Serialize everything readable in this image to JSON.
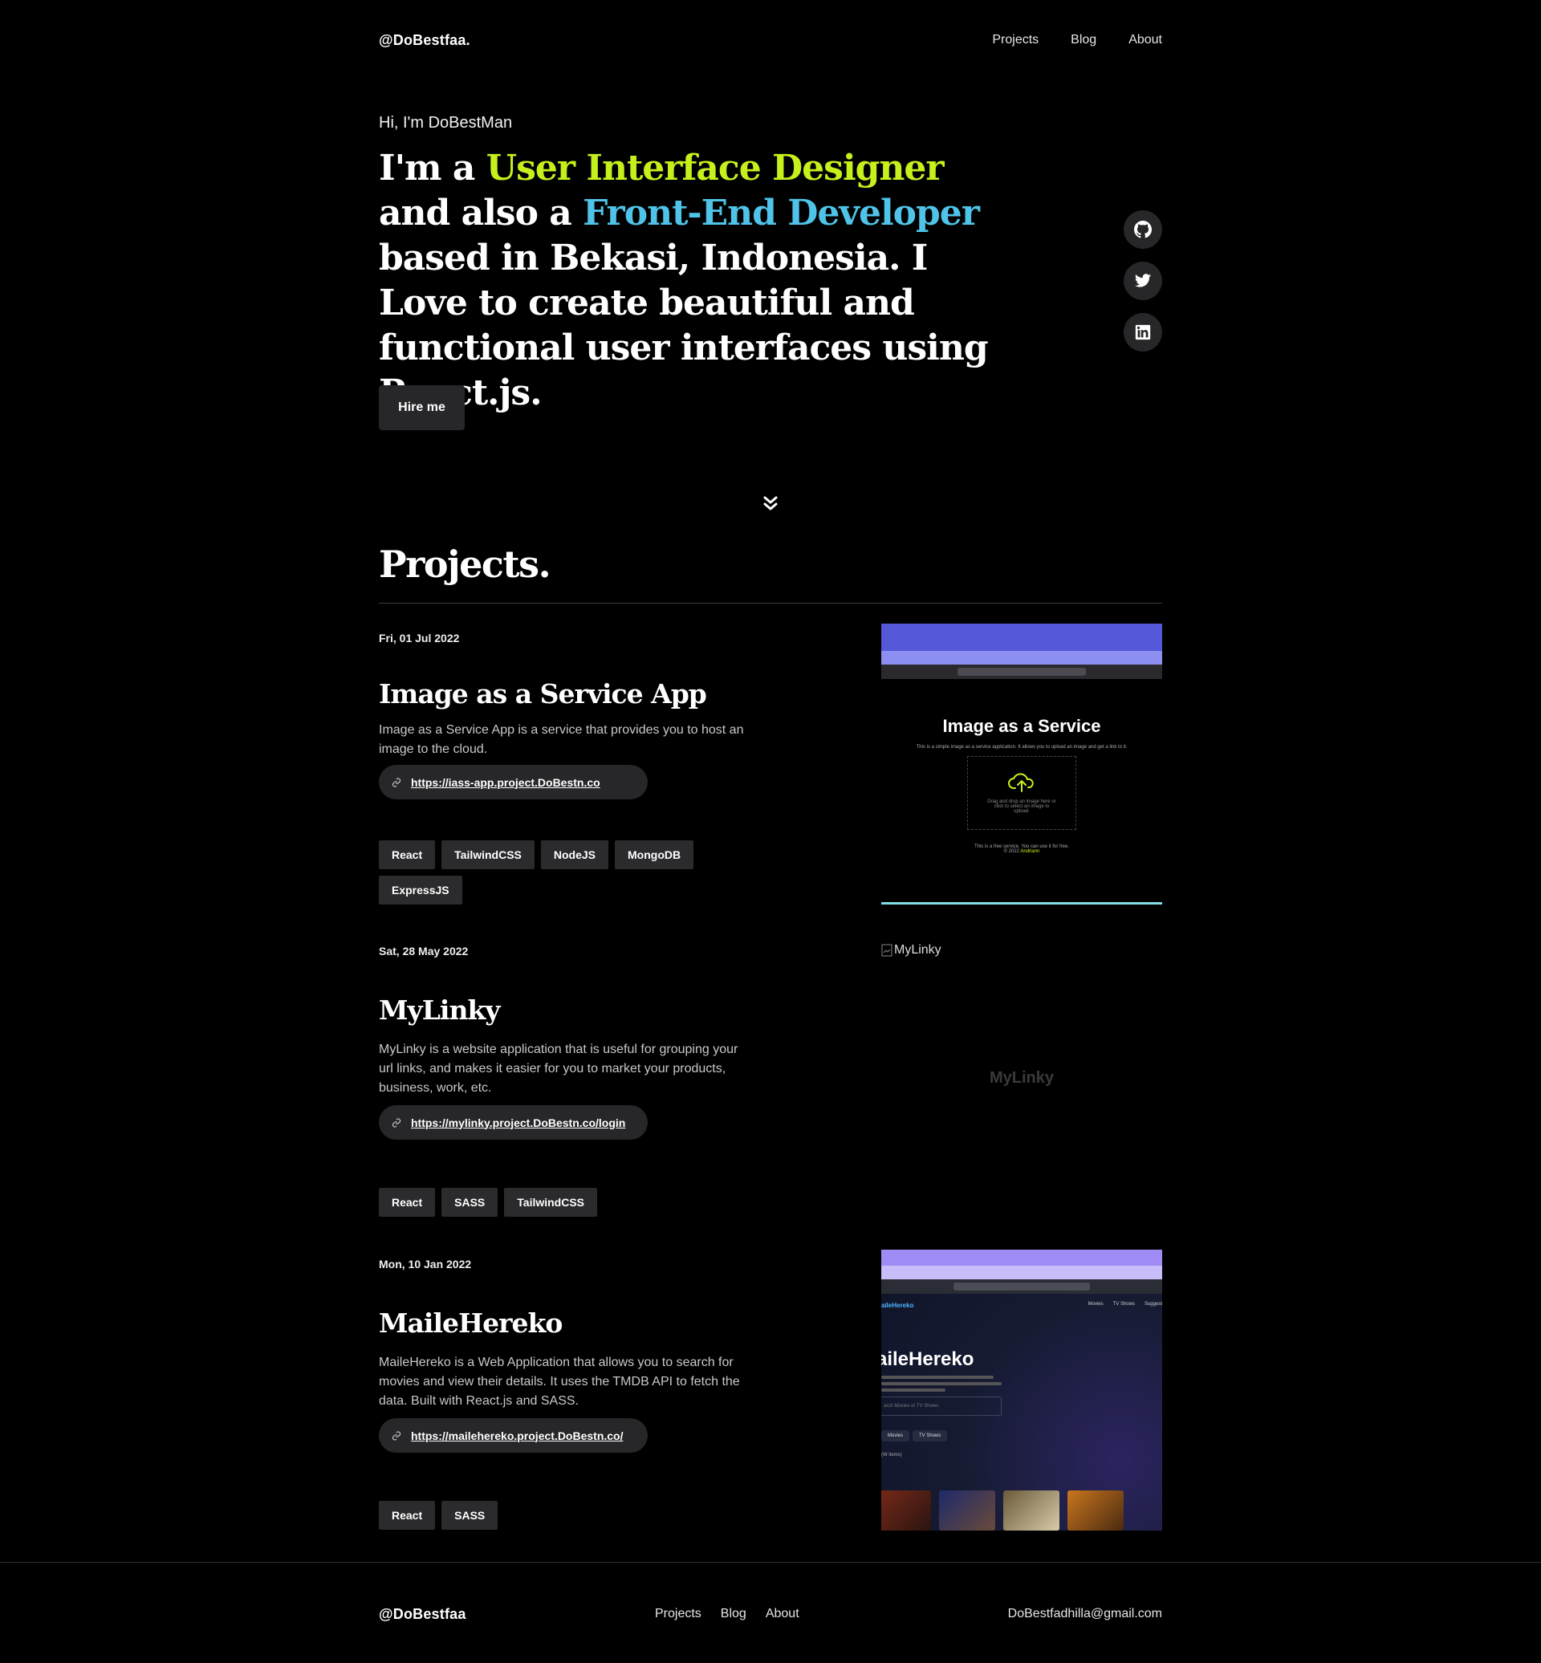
{
  "nav": {
    "brand": "@DoBestfaa.",
    "links": [
      "Projects",
      "Blog",
      "About"
    ]
  },
  "hero": {
    "greeting": "Hi, I'm DoBestMan",
    "title_parts": {
      "p1": "I'm a ",
      "h1": "User Interface Designer",
      "p2": " and also a ",
      "h2": "Front-End Developer",
      "p3": " based in Bekasi, Indonesia. I Love to create beautiful and functional user interfaces using React.js."
    },
    "cta": "Hire me",
    "socials": [
      "github-icon",
      "twitter-icon",
      "linkedin-icon"
    ]
  },
  "projects": {
    "title": "Projects.",
    "items": [
      {
        "date": "Fri, 01 Jul 2022",
        "title": "Image as a Service App",
        "description": "Image as a Service App is a service that provides you to host an image to the cloud.",
        "link": "https://iass-app.project.DoBestn.co",
        "tags": [
          "React",
          "TailwindCSS",
          "NodeJS",
          "MongoDB",
          "ExpressJS"
        ],
        "image": {
          "title": "Image as a Service",
          "subtitle": "This is a simple image as a service application. It allows you to upload an image and get a link to it.",
          "drop_text": "Drag and drop an image here or click to select an image to upload.",
          "footer": "This is a free service. You can use it for free.",
          "copyright": "© 2022 ",
          "author": "Andriann"
        }
      },
      {
        "date": "Sat, 28 May 2022",
        "title": "MyLinky",
        "description": "MyLinky is a website application that is useful for grouping your url links, and makes it easier for you to market your products, business, work, etc.",
        "link": "https://mylinky.project.DoBestn.co/login",
        "tags": [
          "React",
          "SASS",
          "TailwindCSS"
        ],
        "image": {
          "alt": "MyLinky",
          "ghost": "MyLinky"
        }
      },
      {
        "date": "Mon, 10 Jan 2022",
        "title": "MaileHereko",
        "description": "MaileHereko is a Web Application that allows you to search for movies and view their details. It uses the TMDB API to fetch the data. Built with React.js and SASS.",
        "link": "https://mailehereko.project.DoBestn.co/",
        "tags": [
          "React",
          "SASS"
        ],
        "image": {
          "logo": "aileHereko",
          "menu": [
            "Movies",
            "TV Shows",
            "Suggest"
          ],
          "heading": "aileHereko",
          "search_placeholder": "arch Movies or TV Shows",
          "pills": [
            "Movies",
            "TV Shows"
          ],
          "count": "(W items)"
        }
      }
    ]
  },
  "footer": {
    "brand": "@DoBestfaa",
    "links": [
      "Projects",
      "Blog",
      "About"
    ],
    "email": "DoBestfadhilla@gmail.com"
  }
}
